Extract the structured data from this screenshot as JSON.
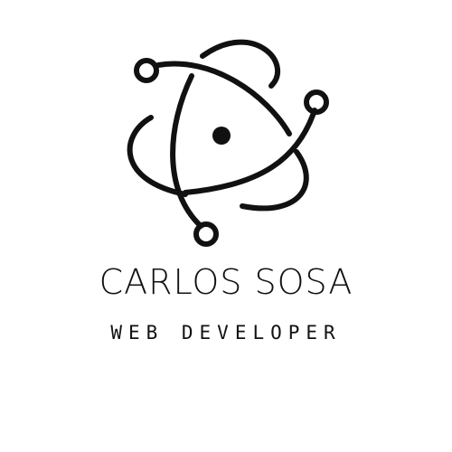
{
  "logo": {
    "icon": "atom-icon",
    "color": "#111111",
    "background": "#ffffff"
  },
  "brand": {
    "name": "CARLOS SOSA",
    "tagline": "WEB DEVELOPER"
  }
}
